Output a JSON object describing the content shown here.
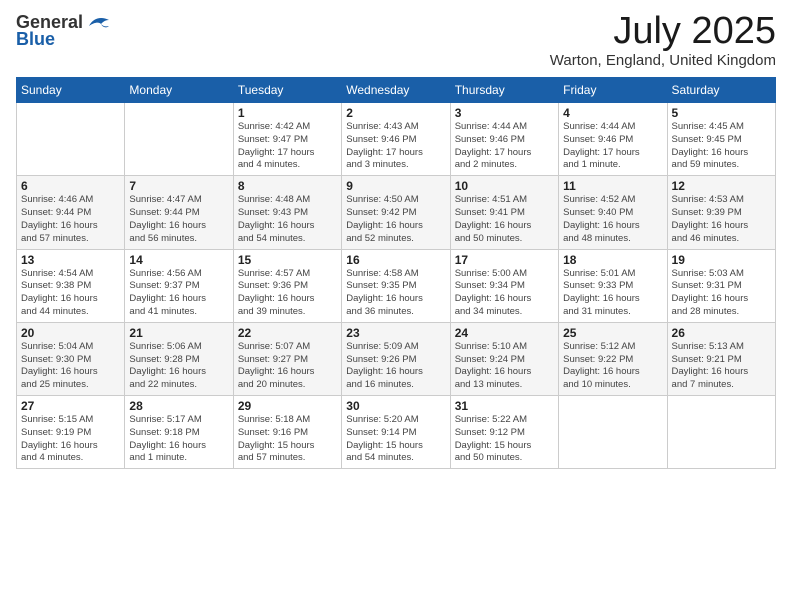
{
  "logo": {
    "general": "General",
    "blue": "Blue"
  },
  "title": "July 2025",
  "subtitle": "Warton, England, United Kingdom",
  "weekdays": [
    "Sunday",
    "Monday",
    "Tuesday",
    "Wednesday",
    "Thursday",
    "Friday",
    "Saturday"
  ],
  "weeks": [
    [
      {
        "day": "",
        "info": ""
      },
      {
        "day": "",
        "info": ""
      },
      {
        "day": "1",
        "info": "Sunrise: 4:42 AM\nSunset: 9:47 PM\nDaylight: 17 hours\nand 4 minutes."
      },
      {
        "day": "2",
        "info": "Sunrise: 4:43 AM\nSunset: 9:46 PM\nDaylight: 17 hours\nand 3 minutes."
      },
      {
        "day": "3",
        "info": "Sunrise: 4:44 AM\nSunset: 9:46 PM\nDaylight: 17 hours\nand 2 minutes."
      },
      {
        "day": "4",
        "info": "Sunrise: 4:44 AM\nSunset: 9:46 PM\nDaylight: 17 hours\nand 1 minute."
      },
      {
        "day": "5",
        "info": "Sunrise: 4:45 AM\nSunset: 9:45 PM\nDaylight: 16 hours\nand 59 minutes."
      }
    ],
    [
      {
        "day": "6",
        "info": "Sunrise: 4:46 AM\nSunset: 9:44 PM\nDaylight: 16 hours\nand 57 minutes."
      },
      {
        "day": "7",
        "info": "Sunrise: 4:47 AM\nSunset: 9:44 PM\nDaylight: 16 hours\nand 56 minutes."
      },
      {
        "day": "8",
        "info": "Sunrise: 4:48 AM\nSunset: 9:43 PM\nDaylight: 16 hours\nand 54 minutes."
      },
      {
        "day": "9",
        "info": "Sunrise: 4:50 AM\nSunset: 9:42 PM\nDaylight: 16 hours\nand 52 minutes."
      },
      {
        "day": "10",
        "info": "Sunrise: 4:51 AM\nSunset: 9:41 PM\nDaylight: 16 hours\nand 50 minutes."
      },
      {
        "day": "11",
        "info": "Sunrise: 4:52 AM\nSunset: 9:40 PM\nDaylight: 16 hours\nand 48 minutes."
      },
      {
        "day": "12",
        "info": "Sunrise: 4:53 AM\nSunset: 9:39 PM\nDaylight: 16 hours\nand 46 minutes."
      }
    ],
    [
      {
        "day": "13",
        "info": "Sunrise: 4:54 AM\nSunset: 9:38 PM\nDaylight: 16 hours\nand 44 minutes."
      },
      {
        "day": "14",
        "info": "Sunrise: 4:56 AM\nSunset: 9:37 PM\nDaylight: 16 hours\nand 41 minutes."
      },
      {
        "day": "15",
        "info": "Sunrise: 4:57 AM\nSunset: 9:36 PM\nDaylight: 16 hours\nand 39 minutes."
      },
      {
        "day": "16",
        "info": "Sunrise: 4:58 AM\nSunset: 9:35 PM\nDaylight: 16 hours\nand 36 minutes."
      },
      {
        "day": "17",
        "info": "Sunrise: 5:00 AM\nSunset: 9:34 PM\nDaylight: 16 hours\nand 34 minutes."
      },
      {
        "day": "18",
        "info": "Sunrise: 5:01 AM\nSunset: 9:33 PM\nDaylight: 16 hours\nand 31 minutes."
      },
      {
        "day": "19",
        "info": "Sunrise: 5:03 AM\nSunset: 9:31 PM\nDaylight: 16 hours\nand 28 minutes."
      }
    ],
    [
      {
        "day": "20",
        "info": "Sunrise: 5:04 AM\nSunset: 9:30 PM\nDaylight: 16 hours\nand 25 minutes."
      },
      {
        "day": "21",
        "info": "Sunrise: 5:06 AM\nSunset: 9:28 PM\nDaylight: 16 hours\nand 22 minutes."
      },
      {
        "day": "22",
        "info": "Sunrise: 5:07 AM\nSunset: 9:27 PM\nDaylight: 16 hours\nand 20 minutes."
      },
      {
        "day": "23",
        "info": "Sunrise: 5:09 AM\nSunset: 9:26 PM\nDaylight: 16 hours\nand 16 minutes."
      },
      {
        "day": "24",
        "info": "Sunrise: 5:10 AM\nSunset: 9:24 PM\nDaylight: 16 hours\nand 13 minutes."
      },
      {
        "day": "25",
        "info": "Sunrise: 5:12 AM\nSunset: 9:22 PM\nDaylight: 16 hours\nand 10 minutes."
      },
      {
        "day": "26",
        "info": "Sunrise: 5:13 AM\nSunset: 9:21 PM\nDaylight: 16 hours\nand 7 minutes."
      }
    ],
    [
      {
        "day": "27",
        "info": "Sunrise: 5:15 AM\nSunset: 9:19 PM\nDaylight: 16 hours\nand 4 minutes."
      },
      {
        "day": "28",
        "info": "Sunrise: 5:17 AM\nSunset: 9:18 PM\nDaylight: 16 hours\nand 1 minute."
      },
      {
        "day": "29",
        "info": "Sunrise: 5:18 AM\nSunset: 9:16 PM\nDaylight: 15 hours\nand 57 minutes."
      },
      {
        "day": "30",
        "info": "Sunrise: 5:20 AM\nSunset: 9:14 PM\nDaylight: 15 hours\nand 54 minutes."
      },
      {
        "day": "31",
        "info": "Sunrise: 5:22 AM\nSunset: 9:12 PM\nDaylight: 15 hours\nand 50 minutes."
      },
      {
        "day": "",
        "info": ""
      },
      {
        "day": "",
        "info": ""
      }
    ]
  ]
}
